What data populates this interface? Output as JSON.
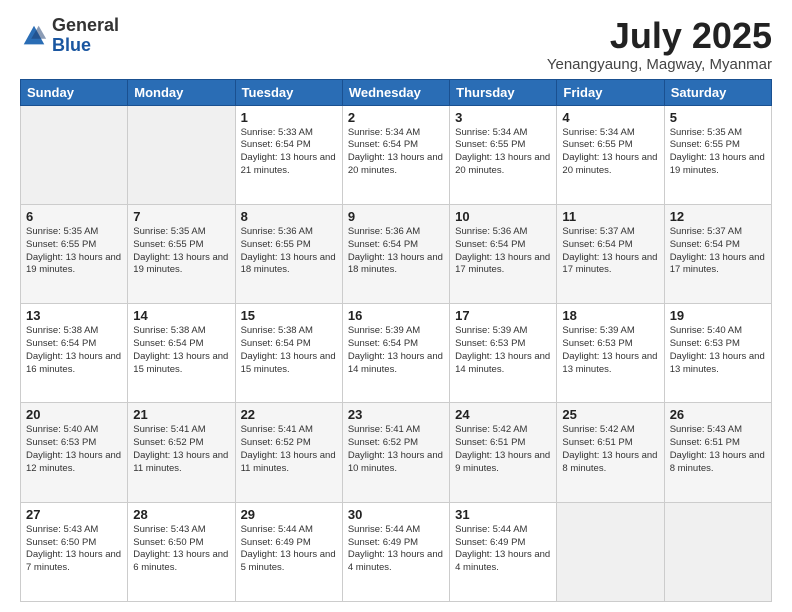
{
  "header": {
    "logo": {
      "line1": "General",
      "line2": "Blue"
    },
    "title": "July 2025",
    "subtitle": "Yenangyaung, Magway, Myanmar"
  },
  "calendar": {
    "days_of_week": [
      "Sunday",
      "Monday",
      "Tuesday",
      "Wednesday",
      "Thursday",
      "Friday",
      "Saturday"
    ],
    "weeks": [
      [
        {
          "day": "",
          "info": ""
        },
        {
          "day": "",
          "info": ""
        },
        {
          "day": "1",
          "info": "Sunrise: 5:33 AM\nSunset: 6:54 PM\nDaylight: 13 hours and 21 minutes."
        },
        {
          "day": "2",
          "info": "Sunrise: 5:34 AM\nSunset: 6:54 PM\nDaylight: 13 hours and 20 minutes."
        },
        {
          "day": "3",
          "info": "Sunrise: 5:34 AM\nSunset: 6:55 PM\nDaylight: 13 hours and 20 minutes."
        },
        {
          "day": "4",
          "info": "Sunrise: 5:34 AM\nSunset: 6:55 PM\nDaylight: 13 hours and 20 minutes."
        },
        {
          "day": "5",
          "info": "Sunrise: 5:35 AM\nSunset: 6:55 PM\nDaylight: 13 hours and 19 minutes."
        }
      ],
      [
        {
          "day": "6",
          "info": "Sunrise: 5:35 AM\nSunset: 6:55 PM\nDaylight: 13 hours and 19 minutes."
        },
        {
          "day": "7",
          "info": "Sunrise: 5:35 AM\nSunset: 6:55 PM\nDaylight: 13 hours and 19 minutes."
        },
        {
          "day": "8",
          "info": "Sunrise: 5:36 AM\nSunset: 6:55 PM\nDaylight: 13 hours and 18 minutes."
        },
        {
          "day": "9",
          "info": "Sunrise: 5:36 AM\nSunset: 6:54 PM\nDaylight: 13 hours and 18 minutes."
        },
        {
          "day": "10",
          "info": "Sunrise: 5:36 AM\nSunset: 6:54 PM\nDaylight: 13 hours and 17 minutes."
        },
        {
          "day": "11",
          "info": "Sunrise: 5:37 AM\nSunset: 6:54 PM\nDaylight: 13 hours and 17 minutes."
        },
        {
          "day": "12",
          "info": "Sunrise: 5:37 AM\nSunset: 6:54 PM\nDaylight: 13 hours and 17 minutes."
        }
      ],
      [
        {
          "day": "13",
          "info": "Sunrise: 5:38 AM\nSunset: 6:54 PM\nDaylight: 13 hours and 16 minutes."
        },
        {
          "day": "14",
          "info": "Sunrise: 5:38 AM\nSunset: 6:54 PM\nDaylight: 13 hours and 15 minutes."
        },
        {
          "day": "15",
          "info": "Sunrise: 5:38 AM\nSunset: 6:54 PM\nDaylight: 13 hours and 15 minutes."
        },
        {
          "day": "16",
          "info": "Sunrise: 5:39 AM\nSunset: 6:54 PM\nDaylight: 13 hours and 14 minutes."
        },
        {
          "day": "17",
          "info": "Sunrise: 5:39 AM\nSunset: 6:53 PM\nDaylight: 13 hours and 14 minutes."
        },
        {
          "day": "18",
          "info": "Sunrise: 5:39 AM\nSunset: 6:53 PM\nDaylight: 13 hours and 13 minutes."
        },
        {
          "day": "19",
          "info": "Sunrise: 5:40 AM\nSunset: 6:53 PM\nDaylight: 13 hours and 13 minutes."
        }
      ],
      [
        {
          "day": "20",
          "info": "Sunrise: 5:40 AM\nSunset: 6:53 PM\nDaylight: 13 hours and 12 minutes."
        },
        {
          "day": "21",
          "info": "Sunrise: 5:41 AM\nSunset: 6:52 PM\nDaylight: 13 hours and 11 minutes."
        },
        {
          "day": "22",
          "info": "Sunrise: 5:41 AM\nSunset: 6:52 PM\nDaylight: 13 hours and 11 minutes."
        },
        {
          "day": "23",
          "info": "Sunrise: 5:41 AM\nSunset: 6:52 PM\nDaylight: 13 hours and 10 minutes."
        },
        {
          "day": "24",
          "info": "Sunrise: 5:42 AM\nSunset: 6:51 PM\nDaylight: 13 hours and 9 minutes."
        },
        {
          "day": "25",
          "info": "Sunrise: 5:42 AM\nSunset: 6:51 PM\nDaylight: 13 hours and 8 minutes."
        },
        {
          "day": "26",
          "info": "Sunrise: 5:43 AM\nSunset: 6:51 PM\nDaylight: 13 hours and 8 minutes."
        }
      ],
      [
        {
          "day": "27",
          "info": "Sunrise: 5:43 AM\nSunset: 6:50 PM\nDaylight: 13 hours and 7 minutes."
        },
        {
          "day": "28",
          "info": "Sunrise: 5:43 AM\nSunset: 6:50 PM\nDaylight: 13 hours and 6 minutes."
        },
        {
          "day": "29",
          "info": "Sunrise: 5:44 AM\nSunset: 6:49 PM\nDaylight: 13 hours and 5 minutes."
        },
        {
          "day": "30",
          "info": "Sunrise: 5:44 AM\nSunset: 6:49 PM\nDaylight: 13 hours and 4 minutes."
        },
        {
          "day": "31",
          "info": "Sunrise: 5:44 AM\nSunset: 6:49 PM\nDaylight: 13 hours and 4 minutes."
        },
        {
          "day": "",
          "info": ""
        },
        {
          "day": "",
          "info": ""
        }
      ]
    ]
  }
}
